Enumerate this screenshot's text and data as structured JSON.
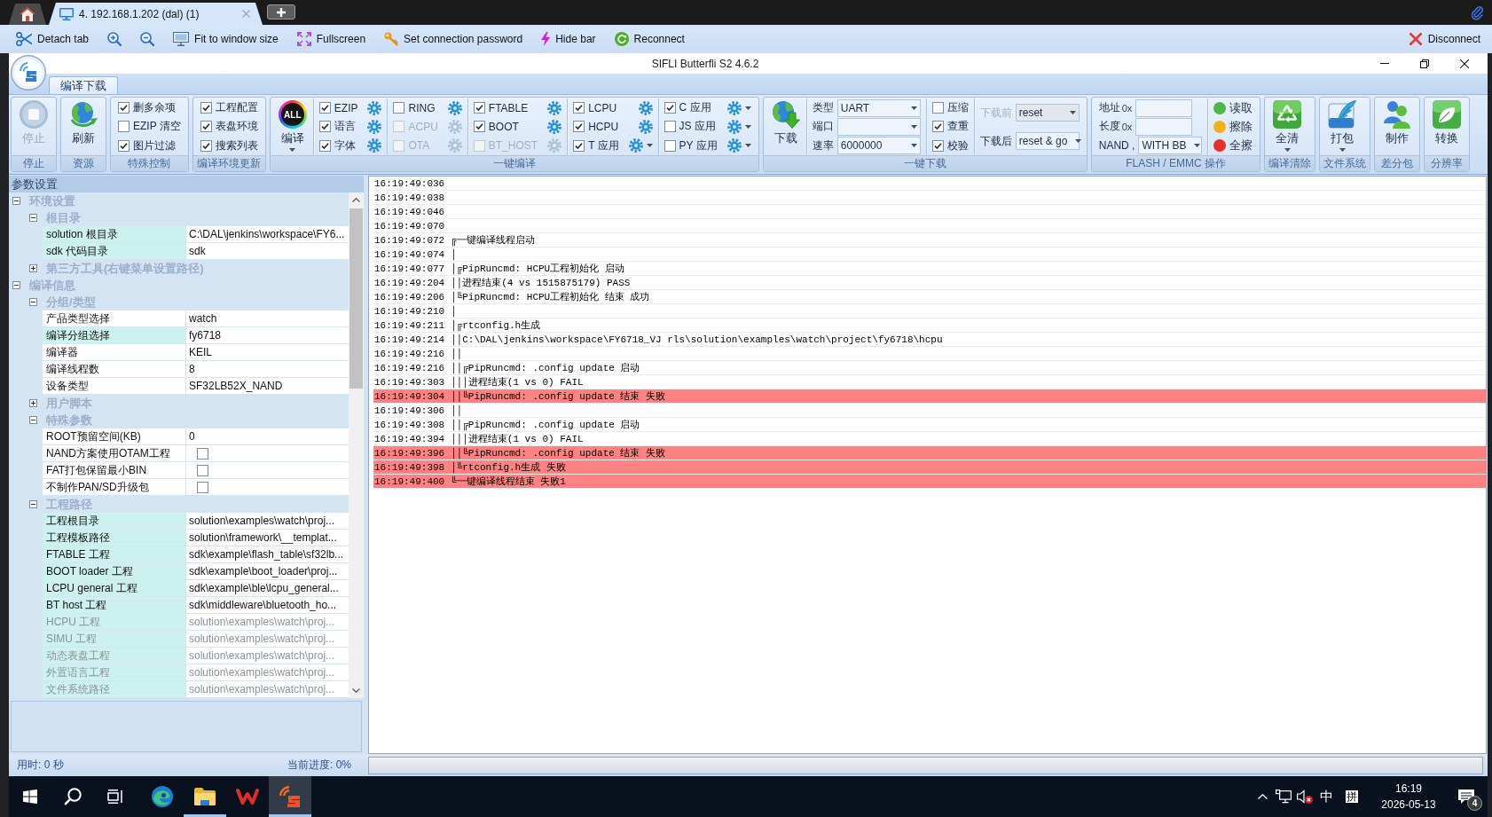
{
  "session_tabs": [
    {
      "label": "4. 192.168.1.202 (dal) (1)",
      "selected": true
    }
  ],
  "connection_toolbar": {
    "items": [
      {
        "kind": "detach",
        "label": "Detach tab"
      },
      {
        "kind": "zoom_in"
      },
      {
        "kind": "zoom_out"
      },
      {
        "kind": "fit",
        "label": "Fit to window size"
      },
      {
        "kind": "fullscreen",
        "label": "Fullscreen"
      },
      {
        "kind": "password",
        "label": "Set connection password"
      },
      {
        "kind": "hide_bar",
        "label": "Hide bar"
      },
      {
        "kind": "reconnect",
        "label": "Reconnect"
      }
    ],
    "disconnect": {
      "label": "Disconnect"
    }
  },
  "window": {
    "title": "SIFLI Butterfli S2 4.6.2"
  },
  "ribbon": {
    "tabs": [
      {
        "label": "编译下载",
        "selected": true
      }
    ],
    "groups": [
      {
        "label": "停止",
        "buttons": [
          {
            "kind": "stop",
            "label": "停止",
            "disabled": true,
            "dropdown": false
          }
        ]
      },
      {
        "label": "资源",
        "buttons": [
          {
            "kind": "globe",
            "label": "刷新",
            "disabled": false,
            "dropdown": false
          }
        ]
      },
      {
        "label": "特殊控制",
        "columns": [
          [
            {
              "kind": "check",
              "label": "删多余项",
              "checked": true,
              "disabled": false
            },
            {
              "kind": "check",
              "label": "EZIP 清空",
              "checked": false,
              "disabled": false
            },
            {
              "kind": "check",
              "label": "图片过滤",
              "checked": true,
              "disabled": false
            }
          ]
        ]
      },
      {
        "label": "编译环境更新",
        "columns": [
          [
            {
              "kind": "check",
              "label": "工程配置",
              "checked": true,
              "disabled": false
            },
            {
              "kind": "check",
              "label": "表盘环境",
              "checked": true,
              "disabled": false
            },
            {
              "kind": "check",
              "label": "搜索列表",
              "checked": true,
              "disabled": false
            }
          ]
        ]
      },
      {
        "label": "一键编译",
        "buttons": [
          {
            "kind": "all",
            "badge": "ALL",
            "label": "编译",
            "disabled": false,
            "dropdown": true
          }
        ],
        "columns": [
          [
            {
              "kind": "check",
              "label": "EZIP",
              "checked": true,
              "disabled": false,
              "gear": true,
              "dropdown": false
            },
            {
              "kind": "check",
              "label": "语言",
              "checked": true,
              "disabled": false,
              "gear": true,
              "dropdown": false
            },
            {
              "kind": "check",
              "label": "字体",
              "checked": true,
              "disabled": false,
              "gear": true,
              "dropdown": false
            }
          ],
          [
            {
              "kind": "check",
              "label": "RING",
              "checked": false,
              "disabled": false,
              "gear": true,
              "dropdown": false
            },
            {
              "kind": "check",
              "label": "ACPU",
              "checked": false,
              "disabled": true,
              "gear": true,
              "dropdown": false
            },
            {
              "kind": "check",
              "label": "OTA",
              "checked": false,
              "disabled": true,
              "gear": true,
              "dropdown": false
            }
          ],
          [
            {
              "kind": "check",
              "label": "FTABLE",
              "checked": true,
              "disabled": false,
              "gear": true,
              "dropdown": false
            },
            {
              "kind": "check",
              "label": "BOOT",
              "checked": true,
              "disabled": false,
              "gear": true,
              "dropdown": false
            },
            {
              "kind": "check",
              "label": "BT_HOST",
              "checked": false,
              "disabled": true,
              "gear": true,
              "dropdown": false
            }
          ],
          [
            {
              "kind": "check",
              "label": "LCPU",
              "checked": true,
              "disabled": false,
              "gear": true,
              "dropdown": false
            },
            {
              "kind": "check",
              "label": "HCPU",
              "checked": true,
              "disabled": false,
              "gear": true,
              "dropdown": false
            },
            {
              "kind": "check",
              "label": "T 应用",
              "checked": true,
              "disabled": false,
              "gear": true,
              "dropdown": true
            }
          ],
          [
            {
              "kind": "check",
              "label": "C 应用",
              "checked": true,
              "disabled": false,
              "gear": true,
              "dropdown": true
            },
            {
              "kind": "check",
              "label": "JS 应用",
              "checked": false,
              "disabled": false,
              "gear": true,
              "dropdown": true
            },
            {
              "kind": "check",
              "label": "PY 应用",
              "checked": false,
              "disabled": false,
              "gear": true,
              "dropdown": true
            }
          ]
        ]
      },
      {
        "label": "一键下载",
        "buttons": [
          {
            "kind": "download",
            "label": "下载",
            "disabled": false,
            "dropdown": false
          }
        ],
        "columns": [
          [
            {
              "kind": "combo",
              "label": "类型",
              "value": "UART",
              "disabled": false
            },
            {
              "kind": "combo",
              "label": "端口",
              "disabled": false
            },
            {
              "kind": "combo",
              "label": "速率",
              "value": "6000000",
              "disabled": false
            }
          ],
          [
            {
              "kind": "check",
              "label": "压缩",
              "checked": false,
              "disabled": false
            },
            {
              "kind": "check",
              "label": "查重",
              "checked": true,
              "disabled": false
            },
            {
              "kind": "check",
              "label": "校验",
              "checked": true,
              "disabled": false
            }
          ],
          [
            {
              "kind": "combo",
              "label": "下载前",
              "value": "reset",
              "disabled": true
            },
            {
              "kind": "combo",
              "label": "下载后",
              "value": "reset & go",
              "disabled": false
            }
          ]
        ]
      },
      {
        "label": "FLASH / EMMC 操作",
        "columns": [
          [
            {
              "kind": "field",
              "label": "地址",
              "prefix": "0x"
            },
            {
              "kind": "field",
              "label": "长度",
              "prefix": "0x"
            },
            {
              "kind": "combo",
              "label": "NAND ,",
              "value": "WITH BB",
              "disabled": false
            }
          ],
          [
            {
              "kind": "action",
              "label": "读取",
              "color": "#4cb848"
            },
            {
              "kind": "action",
              "label": "擦除",
              "color": "#f2b21c"
            },
            {
              "kind": "action",
              "label": "全擦",
              "color": "#e8302a"
            }
          ]
        ]
      },
      {
        "label": "编译清除",
        "buttons": [
          {
            "kind": "recycle",
            "label": "全清",
            "disabled": false,
            "dropdown": true
          }
        ]
      },
      {
        "label": "文件系统",
        "buttons": [
          {
            "kind": "quill",
            "label": "打包",
            "disabled": false,
            "dropdown": true
          }
        ]
      },
      {
        "label": "差分包",
        "buttons": [
          {
            "kind": "people",
            "label": "制作",
            "disabled": false,
            "dropdown": false
          }
        ]
      },
      {
        "label": "分辨率",
        "buttons": [
          {
            "kind": "leaf",
            "label": "转换",
            "disabled": false,
            "dropdown": false
          }
        ]
      }
    ]
  },
  "property_grid": {
    "title": "参数设置",
    "categories": [
      {
        "kind": "category",
        "label": "环境设置",
        "expanded": true,
        "children": [
          {
            "kind": "category",
            "label": "根目录",
            "expanded": true,
            "children": [
              {
                "kind": "text",
                "name": "solution 根目录",
                "value": "C:\\DAL\\jenkins\\workspace\\FY6...",
                "highlighted": true,
                "disabled": false
              },
              {
                "kind": "text",
                "name": "sdk 代码目录",
                "value": "sdk",
                "highlighted": true,
                "disabled": false
              }
            ]
          },
          {
            "kind": "category",
            "label": "第三方工具(右键菜单设置路径)",
            "expanded": false
          }
        ]
      },
      {
        "kind": "category",
        "label": "编译信息",
        "expanded": true,
        "children": [
          {
            "kind": "category",
            "label": "分组/类型",
            "expanded": true,
            "children": [
              {
                "kind": "text",
                "name": "产品类型选择",
                "value": "watch",
                "highlighted": false,
                "disabled": false
              },
              {
                "kind": "text",
                "name": "编译分组选择",
                "value": "fy6718",
                "highlighted": true,
                "disabled": false
              },
              {
                "kind": "text",
                "name": "编译器",
                "value": "KEIL",
                "highlighted": false,
                "disabled": false
              },
              {
                "kind": "text",
                "name": "编译线程数",
                "value": "8",
                "highlighted": false,
                "disabled": false
              },
              {
                "kind": "text",
                "name": "设备类型",
                "value": "SF32LB52X_NAND",
                "highlighted": false,
                "disabled": false
              }
            ]
          },
          {
            "kind": "category",
            "label": "用户脚本",
            "expanded": false
          },
          {
            "kind": "category",
            "label": "特殊参数",
            "expanded": true,
            "children": [
              {
                "kind": "text",
                "name": "ROOT预留空间(KB)",
                "value": "0",
                "highlighted": false,
                "disabled": false
              },
              {
                "kind": "checkbox",
                "name": "NAND方案使用OTAM工程",
                "checked": false,
                "highlighted": false,
                "disabled": false
              },
              {
                "kind": "checkbox",
                "name": "FAT打包保留最小BIN",
                "checked": false,
                "highlighted": false,
                "disabled": false
              },
              {
                "kind": "checkbox",
                "name": "不制作PAN/SD升级包",
                "checked": false,
                "highlighted": false,
                "disabled": false
              }
            ]
          },
          {
            "kind": "category",
            "label": "工程路径",
            "expanded": true,
            "children": [
              {
                "kind": "text",
                "name": "工程根目录",
                "value": "solution\\examples\\watch\\proj...",
                "highlighted": true,
                "disabled": false
              },
              {
                "kind": "text",
                "name": "工程模板路径",
                "value": "solution\\framework\\__templat...",
                "highlighted": true,
                "disabled": false
              },
              {
                "kind": "text",
                "name": "FTABLE 工程",
                "value": "sdk\\example\\flash_table\\sf32lb...",
                "highlighted": true,
                "disabled": false
              },
              {
                "kind": "text",
                "name": "BOOT loader 工程",
                "value": "sdk\\example\\boot_loader\\proj...",
                "highlighted": true,
                "disabled": false
              },
              {
                "kind": "text",
                "name": "LCPU general 工程",
                "value": "sdk\\example\\ble\\lcpu_general...",
                "highlighted": true,
                "disabled": false
              },
              {
                "kind": "text",
                "name": "BT host 工程",
                "value": "sdk\\middleware\\bluetooth_ho...",
                "highlighted": true,
                "disabled": false
              },
              {
                "kind": "text",
                "name": "HCPU 工程",
                "value": "solution\\examples\\watch\\proj...",
                "highlighted": true,
                "disabled": true
              },
              {
                "kind": "text",
                "name": "SIMU 工程",
                "value": "solution\\examples\\watch\\proj...",
                "highlighted": true,
                "disabled": true
              },
              {
                "kind": "text",
                "name": "动态表盘工程",
                "value": "solution\\examples\\watch\\proj...",
                "highlighted": true,
                "disabled": true
              },
              {
                "kind": "text",
                "name": "外置语言工程",
                "value": "solution\\examples\\watch\\proj...",
                "highlighted": true,
                "disabled": true
              },
              {
                "kind": "text",
                "name": "文件系统路径",
                "value": "solution\\examples\\watch\\proj...",
                "highlighted": true,
                "disabled": true
              }
            ]
          }
        ]
      }
    ]
  },
  "log": {
    "rows": [
      {
        "time": "16:19:49:036",
        "error": false
      },
      {
        "time": "16:19:49:038",
        "error": false
      },
      {
        "time": "16:19:49:046",
        "error": false
      },
      {
        "time": "16:19:49:070",
        "error": false
      },
      {
        "time": "16:19:49:072",
        "text": "╔一键编译线程启动",
        "error": false
      },
      {
        "time": "16:19:49:074",
        "text": "│",
        "error": false
      },
      {
        "time": "16:19:49:077",
        "text": "│╔PipRuncmd: HCPU工程初始化 启动",
        "error": false
      },
      {
        "time": "16:19:49:204",
        "text": "││进程结束(4 vs 1515875179) PASS",
        "error": false
      },
      {
        "time": "16:19:49:206",
        "text": "│╚PipRuncmd: HCPU工程初始化 结束 成功",
        "error": false
      },
      {
        "time": "16:19:49:210",
        "text": "│",
        "error": false
      },
      {
        "time": "16:19:49:211",
        "text": "│╔rtconfig.h生成",
        "error": false
      },
      {
        "time": "16:19:49:214",
        "text": "││C:\\DAL\\jenkins\\workspace\\FY6718_VJ rls\\solution\\examples\\watch\\project\\fy6718\\hcpu",
        "error": false
      },
      {
        "time": "16:19:49:216",
        "text": "││",
        "error": false
      },
      {
        "time": "16:19:49:216",
        "text": "││╔PipRuncmd: .config update 启动",
        "error": false
      },
      {
        "time": "16:19:49:303",
        "text": "│││进程结束(1 vs 0) FAIL",
        "error": false
      },
      {
        "time": "16:19:49:304",
        "text": "││╚PipRuncmd: .config update 结束 失败",
        "error": true
      },
      {
        "time": "16:19:49:306",
        "text": "││",
        "error": false
      },
      {
        "time": "16:19:49:308",
        "text": "││╔PipRuncmd: .config update 启动",
        "error": false
      },
      {
        "time": "16:19:49:394",
        "text": "│││进程结束(1 vs 0) FAIL",
        "error": false
      },
      {
        "time": "16:19:49:396",
        "text": "││╚PipRuncmd: .config update 结束 失败",
        "error": true
      },
      {
        "time": "16:19:49:398",
        "text": "│╚rtconfig.h生成 失败",
        "error": true
      },
      {
        "time": "16:19:49:400",
        "text": "╚一键编译线程结束 失败1",
        "error": true
      }
    ]
  },
  "status_bar": {
    "elapsed": "用时: 0 秒",
    "progress_text": "当前进度: 0%",
    "progress": {
      "level": 0
    }
  },
  "taskbar": {
    "apps": [
      {
        "kind": "browser",
        "running": false,
        "selected": false
      },
      {
        "kind": "folder",
        "running": true,
        "selected": false
      },
      {
        "kind": "office",
        "running": false,
        "selected": false
      },
      {
        "kind": "app",
        "running": true,
        "selected": true
      }
    ],
    "tray": {
      "volume_muted": true,
      "ime_mode": "中",
      "ime": "拼",
      "time": "16:19",
      "date": "2026-05-13",
      "notifications": "4"
    }
  }
}
